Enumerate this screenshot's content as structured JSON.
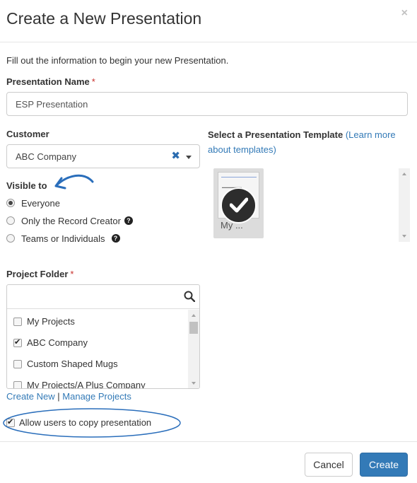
{
  "modal": {
    "title": "Create a New Presentation",
    "close_glyph": "×",
    "intro": "Fill out the information to begin your new Presentation."
  },
  "presentation_name": {
    "label": "Presentation Name",
    "required_mark": "*",
    "value": "ESP Presentation"
  },
  "customer": {
    "label": "Customer",
    "value": "ABC Company",
    "clear_glyph": "✖"
  },
  "template": {
    "label": "Select a Presentation Template",
    "learn_more": "(Learn more about templates)",
    "card_name": "My ..."
  },
  "visibility": {
    "label": "Visible to",
    "options": [
      {
        "label": "Everyone",
        "selected": true
      },
      {
        "label": "Only the Record Creator",
        "help": true,
        "selected": false
      },
      {
        "label": "Teams or Individuals",
        "help": true,
        "selected": false
      }
    ]
  },
  "project_folder": {
    "label": "Project Folder",
    "required_mark": "*",
    "items": [
      {
        "label": "My Projects",
        "checked": false
      },
      {
        "label": "ABC Company",
        "checked": true
      },
      {
        "label": "Custom Shaped Mugs",
        "checked": false
      },
      {
        "label": "My Projects/A Plus Company",
        "checked": false
      }
    ],
    "create_new": "Create New",
    "separator": "|",
    "manage": "Manage Projects"
  },
  "allow_copy": {
    "label": "Allow users to copy presentation",
    "checked": true
  },
  "footer": {
    "cancel": "Cancel",
    "create": "Create"
  },
  "colors": {
    "link": "#337ab7",
    "primary": "#337ab7",
    "annotation": "#2a6ebb"
  }
}
